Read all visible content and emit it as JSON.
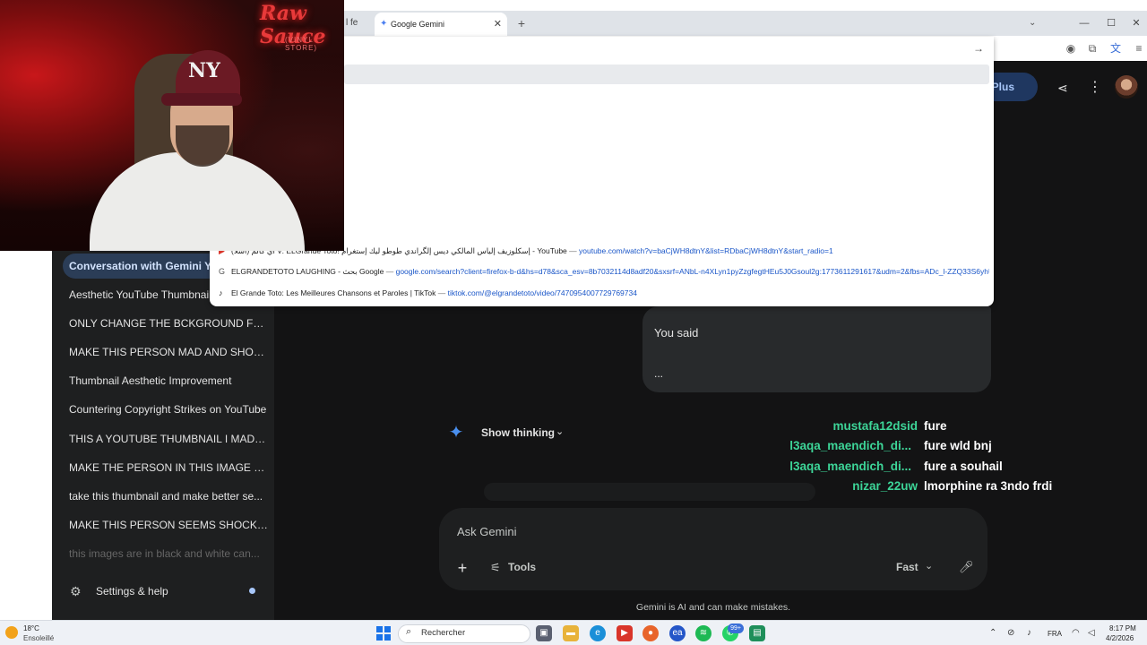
{
  "browser": {
    "prev_tab_label": "l fe",
    "active_tab_label": "Google Gemini",
    "tab_close": "✕",
    "new_tab": "+",
    "omnibox_suggestions": [
      {
        "icon": "youtube-icon",
        "title": "(اسلا) اي كالم V: ELGrande Toto! إسكلوزيف إلياس المالكي ديس إلگراندي طوطو ليك إستغرام - YouTube",
        "sep": " — ",
        "url": "youtube.com/watch?v=baCjWH8dtnY&list=RDbaCjWH8dtnY&start_radio=1"
      },
      {
        "icon": "google-icon",
        "title": "ELGRANDETOTO LAUGHING - بحث Google",
        "sep": " — ",
        "url": "google.com/search?client=firefox-b-d&hs=d78&sca_esv=8b7032114d8adf20&sxsrf=ANbL-n4XLyn1pyZzgfegtHEu5J0Gsoul2g:1773611291617&udm=2&fbs=ADc_l-ZZQ33S6yhUgl80Fe"
      },
      {
        "icon": "tiktok-icon",
        "title": "El Grande Toto: Les Meilleures Chansons et Paroles | TikTok",
        "sep": " — ",
        "url": "tiktok.com/@elgrandetoto/video/7470954007729769734"
      }
    ]
  },
  "webcam": {
    "neon_text": "Raw Sauce",
    "neon_sub": "(VINYL STORE)",
    "cap_logo": "NY"
  },
  "gemini": {
    "plan_button": "l Plus",
    "sidebar": {
      "conversations": [
        {
          "label": "Conversation with Gemini You...",
          "active": true
        },
        {
          "label": "Aesthetic YouTube Thumbnail..."
        },
        {
          "label": "ONLY CHANGE THE BCKGROUND FRO..."
        },
        {
          "label": "MAKE THIS PERSON MAD AND SHOUT..."
        },
        {
          "label": "Thumbnail Aesthetic Improvement"
        },
        {
          "label": "Countering Copyright Strikes on YouTube"
        },
        {
          "label": "THIS A YOUTUBE THUMBNAIL I MADE I..."
        },
        {
          "label": "MAKE THE PERSON IN THIS IMAGE SEE..."
        },
        {
          "label": "take this thumbnail and make better se..."
        },
        {
          "label": "MAKE THIS PERSON SEEMS SHOCKED ..."
        },
        {
          "label": "this images are in black and white can...",
          "faded": true
        }
      ],
      "settings_label": "Settings & help"
    },
    "conversation": {
      "you_said": "You said",
      "you_ellipsis": "...",
      "show_thinking": "Show thinking"
    },
    "input": {
      "placeholder": "Ask Gemini",
      "tools_label": "Tools",
      "mode_label": "Fast"
    },
    "disclaimer": "Gemini is AI and can make mistakes."
  },
  "stream_chat": [
    {
      "user": "mustafa12dsid",
      "message": "fure"
    },
    {
      "user": "l3aqa_maendich_di...",
      "message": "fure wld bnj"
    },
    {
      "user": "l3aqa_maendich_di...",
      "message": "fure a souhail"
    },
    {
      "user": "nizar_22uw",
      "message": "lmorphine ra 3ndo frdi"
    }
  ],
  "taskbar": {
    "weather_temp": "18°C",
    "weather_desc": "Ensoleillé",
    "search_placeholder": "Rechercher",
    "badge_count": "99+",
    "lang": "FRA",
    "time": "8:17 PM",
    "date": "4/2/2026"
  },
  "colors": {
    "page_bg": "#131314",
    "sidebar_bg": "#1e1f20",
    "chat_username": "#3dd598",
    "accent": "#a8c7fa"
  }
}
